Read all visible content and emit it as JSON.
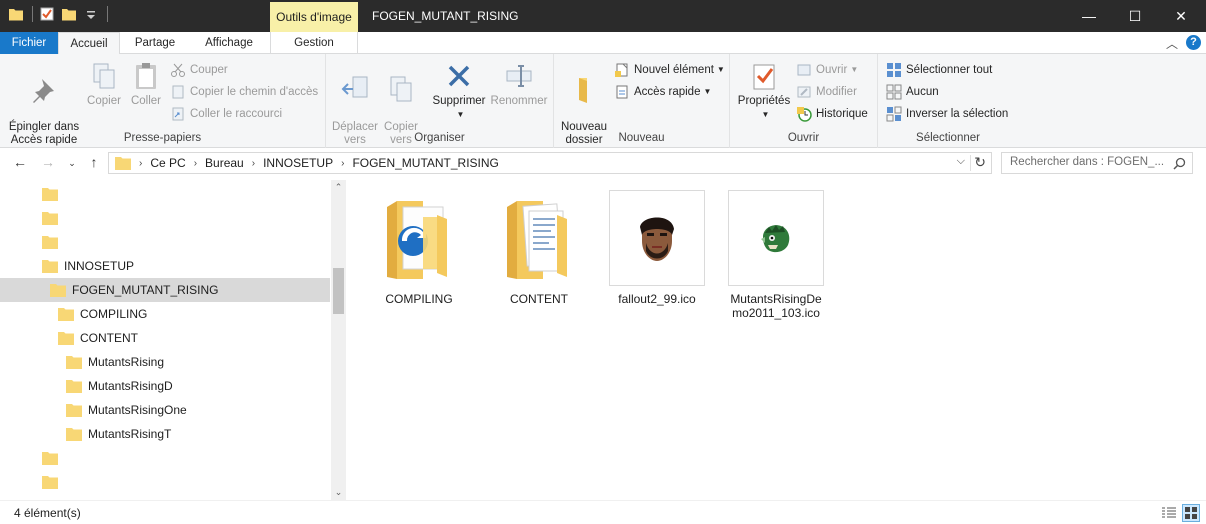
{
  "window": {
    "title": "FOGEN_MUTANT_RISING",
    "contextual_header": "Outils d'image",
    "controls": {
      "minimize": "—",
      "maximize": "☐",
      "close": "✕"
    }
  },
  "tabs": {
    "file": "Fichier",
    "home": "Accueil",
    "share": "Partage",
    "view": "Affichage",
    "manage": "Gestion"
  },
  "ribbon": {
    "clipboard": {
      "label": "Presse-papiers",
      "pin": "Épingler dans\nAccès rapide",
      "copy": "Copier",
      "paste": "Coller",
      "cut": "Couper",
      "copy_path": "Copier le chemin d'accès",
      "paste_shortcut": "Coller le raccourci"
    },
    "organize": {
      "label": "Organiser",
      "move_to": "Déplacer\nvers",
      "copy_to": "Copier\nvers",
      "delete": "Supprimer",
      "rename": "Renommer"
    },
    "new": {
      "label": "Nouveau",
      "new_folder": "Nouveau\ndossier",
      "new_item": "Nouvel élément",
      "easy_access": "Accès rapide"
    },
    "open": {
      "label": "Ouvrir",
      "properties": "Propriétés",
      "open": "Ouvrir",
      "edit": "Modifier",
      "history": "Historique"
    },
    "select": {
      "label": "Sélectionner",
      "select_all": "Sélectionner tout",
      "select_none": "Aucun",
      "invert": "Inverser la sélection"
    }
  },
  "address": {
    "crumbs": [
      "Ce PC",
      "Bureau",
      "INNOSETUP",
      "FOGEN_MUTANT_RISING"
    ]
  },
  "search": {
    "placeholder": "Rechercher dans : FOGEN_..."
  },
  "tree": [
    {
      "label": "",
      "level": 0
    },
    {
      "label": "",
      "level": 0
    },
    {
      "label": "",
      "level": 0
    },
    {
      "label": "INNOSETUP",
      "level": 0
    },
    {
      "label": "FOGEN_MUTANT_RISING",
      "level": 1,
      "selected": true
    },
    {
      "label": "COMPILING",
      "level": 2
    },
    {
      "label": "CONTENT",
      "level": 2
    },
    {
      "label": "MutantsRising",
      "level": 3
    },
    {
      "label": "MutantsRisingD",
      "level": 3
    },
    {
      "label": "MutantsRisingOne",
      "level": 3
    },
    {
      "label": "MutantsRisingT",
      "level": 3
    },
    {
      "label": "",
      "level": 0
    },
    {
      "label": "",
      "level": 0
    },
    {
      "label": "",
      "level": 0
    }
  ],
  "files": [
    {
      "name": "COMPILING",
      "kind": "folder-setup"
    },
    {
      "name": "CONTENT",
      "kind": "folder-docs"
    },
    {
      "name": "fallout2_99.ico",
      "kind": "ico-face"
    },
    {
      "name": "MutantsRisingDemo2011_103.ico",
      "kind": "ico-mutant"
    }
  ],
  "status": {
    "count": "4 élément(s)"
  },
  "colors": {
    "file_tab": "#1979ca",
    "contextual": "#f8f0a8",
    "folder": "#f8d775",
    "selection": "#d9d9d9"
  }
}
